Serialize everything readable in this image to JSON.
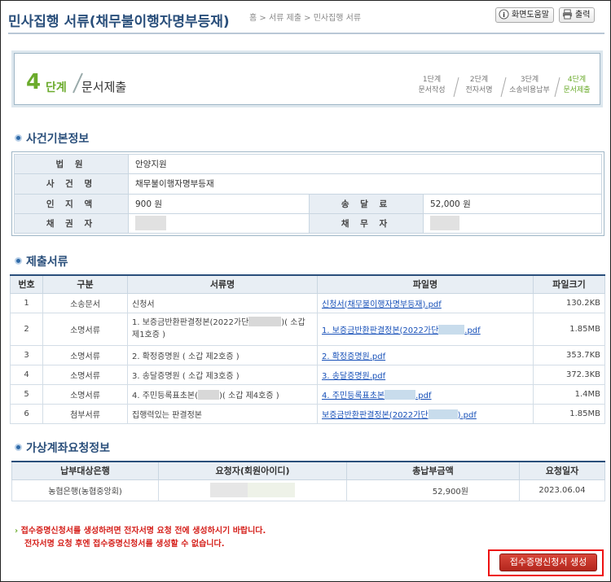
{
  "header": {
    "title": "민사집행 서류(채무불이행자명부등재)",
    "breadcrumb": [
      "홈",
      "서류 제출",
      "민사집행 서류"
    ],
    "help_button": "화면도움말",
    "print_button": "출력"
  },
  "step": {
    "current_number": "4",
    "current_suffix": "단계",
    "current_name": "문서제출",
    "steps": [
      {
        "line1": "1단계",
        "line2": "문서작성",
        "active": false
      },
      {
        "line1": "2단계",
        "line2": "전자서명",
        "active": false
      },
      {
        "line1": "3단계",
        "line2": "소송비용납부",
        "active": false
      },
      {
        "line1": "4단계",
        "line2": "문서제출",
        "active": true
      }
    ]
  },
  "case_info": {
    "heading": "사건기본정보",
    "court_label": "법 원",
    "court_value": "안양지원",
    "case_name_label": "사 건 명",
    "case_name_value": "채무불이행자명부등재",
    "stamp_label": "인 지 액",
    "stamp_value": "900 원",
    "delivery_label": "송 달 료",
    "delivery_value": "52,000 원",
    "creditor_label": "채 권 자",
    "debtor_label": "채 무 자"
  },
  "documents": {
    "heading": "제출서류",
    "columns": [
      "번호",
      "구분",
      "서류명",
      "파일명",
      "파일크기"
    ],
    "rows": [
      {
        "no": "1",
        "type": "소송문서",
        "name": "신청서",
        "file": "신청서(채무불이행자명부등재).pdf",
        "size": "130.2KB"
      },
      {
        "no": "2",
        "type": "소명서류",
        "name_pre": "1. 보증금반환판결정본(2022가단",
        "name_post": ")( 소갑 제1호증 )",
        "file_pre": "1. 보증금반환판결정본(2022가단",
        "file_post": ".pdf",
        "size": "1.85MB"
      },
      {
        "no": "3",
        "type": "소명서류",
        "name": "2. 확정증명원 ( 소갑 제2호증 )",
        "file": "2. 확정증명원.pdf",
        "size": "353.7KB"
      },
      {
        "no": "4",
        "type": "소명서류",
        "name": "3. 송달증명원 ( 소갑 제3호증 )",
        "file": "3. 송달증명원.pdf",
        "size": "372.3KB"
      },
      {
        "no": "5",
        "type": "소명서류",
        "name_pre": "4. 주민등록표초본(",
        "name_post": ")( 소갑 제4호증 )",
        "file_pre": "4. 주민등록표초본",
        "file_post": ".pdf",
        "size": "1.4MB"
      },
      {
        "no": "6",
        "type": "첨부서류",
        "name": "집행력있는 판결정본",
        "file_pre": "보증금반환판결정본(2022가단",
        "file_post": ").pdf",
        "size": "1.85MB"
      }
    ]
  },
  "account": {
    "heading": "가상계좌요청정보",
    "columns": [
      "납부대상은행",
      "요청자(회원아이디)",
      "총납부금액",
      "요청일자"
    ],
    "bank": "농협은행(농협중앙회)",
    "amount": "52,900원",
    "date": "2023.06.04"
  },
  "notice": {
    "line1": "접수증명신청서를 생성하려면 전자서명 요청 전에 생성하시기 바랍니다.",
    "line2": "전자서명 요청 후엔 접수증명신청서를 생성할 수 없습니다."
  },
  "generate_button": "접수증명신청서 생성",
  "colors": {
    "title": "#2a4f7b",
    "accent_green": "#6bab2c",
    "notice_red": "#d5201b",
    "button_red": "#c0392b"
  }
}
